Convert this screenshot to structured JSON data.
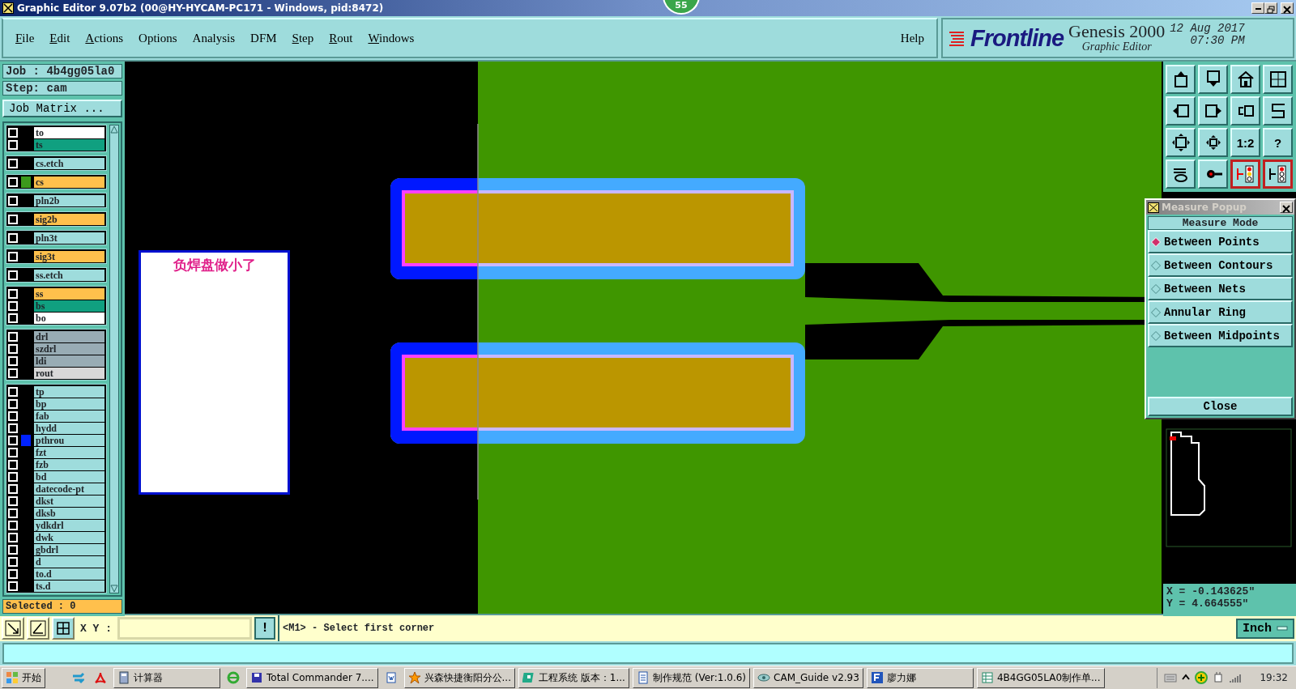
{
  "window": {
    "title": "Graphic Editor 9.07b2 (00@HY-HYCAM-PC171 - Windows, pid:8472)",
    "badge": "55"
  },
  "menu": [
    {
      "label": "File",
      "underlined": true
    },
    {
      "label": "Edit",
      "underlined": true
    },
    {
      "label": "Actions",
      "underlined": true
    },
    {
      "label": "Options",
      "underlined": false
    },
    {
      "label": "Analysis",
      "underlined": false
    },
    {
      "label": "DFM",
      "underlined": false
    },
    {
      "label": "Step",
      "underlined": true
    },
    {
      "label": "Rout",
      "underlined": true
    },
    {
      "label": "Windows",
      "underlined": true
    }
  ],
  "help": "Help",
  "brand": {
    "logo": "Frontline",
    "product": "Genesis 2000",
    "subtitle": "Graphic Editor",
    "date": "12 Aug 2017",
    "time": "07:30 PM"
  },
  "job": {
    "job": "Job : 4b4gg05la0",
    "step": "Step: cam",
    "matrix_button": "Job Matrix ..."
  },
  "layer_groups": [
    {
      "layers": [
        {
          "name": "to",
          "color": "#ffffff",
          "checked": false
        },
        {
          "name": "ts",
          "color": "#10a080",
          "checked": false
        }
      ]
    },
    {
      "layers": [
        {
          "name": "cs.etch",
          "color": "#9edcdc",
          "checked": false
        }
      ]
    },
    {
      "layers": [
        {
          "name": "cs",
          "color": "#ffc04c",
          "checked": false,
          "marker": {
            "color": "#3c9a1c"
          }
        }
      ]
    },
    {
      "layers": [
        {
          "name": "pln2b",
          "color": "#9edcdc",
          "checked": false
        }
      ]
    },
    {
      "layers": [
        {
          "name": "sig2b",
          "color": "#ffc04c",
          "checked": false
        }
      ]
    },
    {
      "layers": [
        {
          "name": "pln3t",
          "color": "#9edcdc",
          "checked": false
        }
      ]
    },
    {
      "layers": [
        {
          "name": "sig3t",
          "color": "#ffc04c",
          "checked": false
        }
      ]
    },
    {
      "layers": [
        {
          "name": "ss.etch",
          "color": "#9edcdc",
          "checked": false
        }
      ]
    },
    {
      "layers": [
        {
          "name": "ss",
          "color": "#ffc04c",
          "checked": false
        },
        {
          "name": "bs",
          "color": "#10a080",
          "checked": false
        },
        {
          "name": "bo",
          "color": "#ffffff",
          "checked": false
        }
      ]
    },
    {
      "layers": [
        {
          "name": "drl",
          "color": "#98acb4",
          "checked": false
        },
        {
          "name": "szdrl",
          "color": "#98acb4",
          "checked": false
        },
        {
          "name": "ldi",
          "color": "#98acb4",
          "checked": false
        },
        {
          "name": "rout",
          "color": "#d8d8d8",
          "checked": false
        }
      ]
    },
    {
      "layers": [
        {
          "name": "tp",
          "color": "#9edcdc",
          "checked": false
        },
        {
          "name": "bp",
          "color": "#9edcdc",
          "checked": false
        },
        {
          "name": "fab",
          "color": "#9edcdc",
          "checked": false
        },
        {
          "name": "hydd",
          "color": "#9edcdc",
          "checked": false
        },
        {
          "name": "pthrou",
          "color": "#9edcdc",
          "checked": false,
          "marker": {
            "color": "#0022ff"
          }
        },
        {
          "name": "fzt",
          "color": "#9edcdc",
          "checked": false
        },
        {
          "name": "fzb",
          "color": "#9edcdc",
          "checked": false
        },
        {
          "name": "bd",
          "color": "#9edcdc",
          "checked": false
        },
        {
          "name": "datecode-pt",
          "color": "#9edcdc",
          "checked": false
        },
        {
          "name": "dkst",
          "color": "#9edcdc",
          "checked": false
        },
        {
          "name": "dksb",
          "color": "#9edcdc",
          "checked": false
        },
        {
          "name": "ydkdrl",
          "color": "#9edcdc",
          "checked": false
        },
        {
          "name": "dwk",
          "color": "#9edcdc",
          "checked": false
        },
        {
          "name": "gbdrl",
          "color": "#9edcdc",
          "checked": false
        },
        {
          "name": "d",
          "color": "#9edcdc",
          "checked": false
        },
        {
          "name": "to.d",
          "color": "#9edcdc",
          "checked": false
        },
        {
          "name": "ts.d",
          "color": "#9edcdc",
          "checked": false
        }
      ]
    }
  ],
  "selected": "Selected : 0",
  "canvas": {
    "note": "负焊盘做小了"
  },
  "tools": [
    {
      "highlighted": false
    },
    {
      "highlighted": false
    },
    {
      "highlighted": false
    },
    {
      "highlighted": false
    },
    {
      "highlighted": false
    },
    {
      "highlighted": false
    },
    {
      "highlighted": false
    },
    {
      "highlighted": false
    },
    {
      "highlighted": false
    },
    {
      "highlighted": false
    },
    {
      "highlighted": false,
      "label": "1:2"
    },
    {
      "highlighted": false,
      "label": "?"
    },
    {
      "highlighted": false
    },
    {
      "highlighted": false
    },
    {
      "highlighted": true
    },
    {
      "highlighted": true
    }
  ],
  "measure_popup": {
    "title": "Measure Popup",
    "heading": "Measure Mode",
    "modes": [
      {
        "label": "Between Points",
        "selected": true
      },
      {
        "label": "Between Contours",
        "selected": false
      },
      {
        "label": "Between Nets",
        "selected": false
      },
      {
        "label": "Annular Ring",
        "selected": false
      },
      {
        "label": "Between Midpoints",
        "selected": false
      }
    ],
    "close": "Close"
  },
  "coords": {
    "x": "X = -0.143625\"",
    "y": "Y = 4.664555\""
  },
  "command": {
    "xy_label": "X Y :",
    "bang": "!",
    "prompt": "<M1> - Select first corner",
    "units": "Inch"
  },
  "taskbar": {
    "start": "开始",
    "items": [
      {
        "kind": "launcher"
      },
      {
        "kind": "launcher"
      },
      {
        "kind": "task",
        "label": "计算器"
      },
      {
        "kind": "launcher"
      },
      {
        "kind": "task",
        "label": "Total Commander 7...."
      },
      {
        "kind": "launcher"
      },
      {
        "kind": "task",
        "label": "兴森快捷衡阳分公..."
      },
      {
        "kind": "task",
        "label": "工程系统  版本：1..."
      },
      {
        "kind": "task",
        "label": "制作规范 (Ver:1.0.6)"
      },
      {
        "kind": "task",
        "label": "CAM_Guide v2.93"
      },
      {
        "kind": "task",
        "label": "廖力娜"
      },
      {
        "kind": "task",
        "label": "4B4GG05LA0制作单..."
      }
    ],
    "clock": "19:32"
  }
}
